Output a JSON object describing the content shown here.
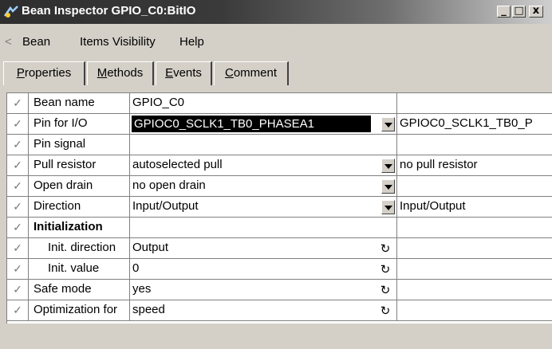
{
  "window": {
    "title": "Bean Inspector GPIO_C0:BitIO",
    "controls": {
      "minimize": "_",
      "maximize": "□",
      "close": "x"
    }
  },
  "menu": {
    "back": "<",
    "items": [
      "Bean",
      "Items Visibility",
      "Help"
    ]
  },
  "tabs": [
    {
      "label": "Properties",
      "accel": "P",
      "rest": "roperties"
    },
    {
      "label": "Methods",
      "accel": "M",
      "rest": "ethods"
    },
    {
      "label": "Events",
      "accel": "E",
      "rest": "vents"
    },
    {
      "label": "Comment",
      "accel": "C",
      "rest": "omment"
    }
  ],
  "check_glyph": "✓",
  "reset_glyph": "↻",
  "rows": [
    {
      "name": "Bean name",
      "value": "GPIO_C0",
      "extra": ""
    },
    {
      "name": "Pin for I/O",
      "value": "GPIOC0_SCLK1_TB0_PHASEA1",
      "extra": "GPIOC0_SCLK1_TB0_P",
      "selected": true,
      "control": "dropdown"
    },
    {
      "name": "Pin signal",
      "value": "",
      "extra": ""
    },
    {
      "name": "Pull resistor",
      "value": "autoselected pull",
      "extra": "no pull resistor",
      "control": "dropdown"
    },
    {
      "name": "Open drain",
      "value": "no open drain",
      "extra": "",
      "control": "dropdown"
    },
    {
      "name": "Direction",
      "value": "Input/Output",
      "extra": "Input/Output",
      "control": "dropdown"
    },
    {
      "name": "Initialization",
      "value": "",
      "extra": "",
      "bold": true
    },
    {
      "name": "Init. direction",
      "value": "Output",
      "extra": "",
      "indent": true,
      "control": "reset"
    },
    {
      "name": "Init. value",
      "value": "0",
      "extra": "",
      "indent": true,
      "control": "reset"
    },
    {
      "name": "Safe mode",
      "value": "yes",
      "extra": "",
      "control": "reset"
    },
    {
      "name": "Optimization for",
      "value": "speed",
      "extra": "",
      "control": "reset"
    }
  ]
}
